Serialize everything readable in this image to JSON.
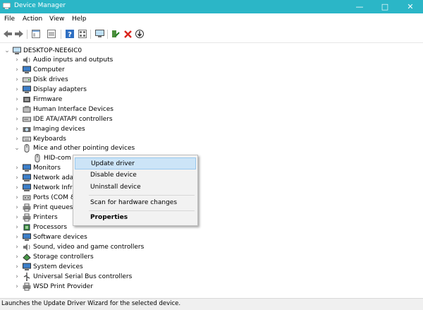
{
  "window": {
    "title": "Device Manager",
    "accent": "#2bb6c7",
    "controls": [
      "minimize-icon",
      "maximize-icon",
      "close-icon"
    ]
  },
  "menubar": [
    "File",
    "Action",
    "View",
    "Help"
  ],
  "toolbar": [
    "back-arrow-icon",
    "forward-arrow-icon",
    "console-tree-icon",
    "properties-icon",
    "help-icon",
    "view-icon",
    "monitor-icon",
    "add-driver-icon",
    "uninstall-x-icon",
    "download-icon"
  ],
  "tree": {
    "root": "DESKTOP-NEE6IC0",
    "items": [
      {
        "label": "Audio inputs and outputs",
        "icon": "speaker-icon"
      },
      {
        "label": "Computer",
        "icon": "computer-icon"
      },
      {
        "label": "Disk drives",
        "icon": "disk-icon"
      },
      {
        "label": "Display adapters",
        "icon": "display-adapter-icon"
      },
      {
        "label": "Firmware",
        "icon": "firmware-icon"
      },
      {
        "label": "Human Interface Devices",
        "icon": "hid-icon"
      },
      {
        "label": "IDE ATA/ATAPI controllers",
        "icon": "ide-icon"
      },
      {
        "label": "Imaging devices",
        "icon": "camera-icon"
      },
      {
        "label": "Keyboards",
        "icon": "keyboard-icon"
      },
      {
        "label": "Mice and other pointing devices",
        "icon": "mouse-icon",
        "expanded": true
      },
      {
        "label": "HID-com",
        "icon": "mouse-icon",
        "child": true
      },
      {
        "label": "Monitors",
        "icon": "monitor-icon"
      },
      {
        "label": "Network adap",
        "icon": "network-icon"
      },
      {
        "label": "Network Infra",
        "icon": "network-icon"
      },
      {
        "label": "Ports (COM &",
        "icon": "port-icon"
      },
      {
        "label": "Print queues",
        "icon": "printer-icon"
      },
      {
        "label": "Printers",
        "icon": "printer-icon"
      },
      {
        "label": "Processors",
        "icon": "processor-icon"
      },
      {
        "label": "Software devices",
        "icon": "software-icon"
      },
      {
        "label": "Sound, video and game controllers",
        "icon": "speaker-icon"
      },
      {
        "label": "Storage controllers",
        "icon": "storage-icon"
      },
      {
        "label": "System devices",
        "icon": "system-icon"
      },
      {
        "label": "Universal Serial Bus controllers",
        "icon": "usb-icon"
      },
      {
        "label": "WSD Print Provider",
        "icon": "printer-icon"
      }
    ]
  },
  "context_menu": {
    "items": [
      {
        "label": "Update driver",
        "highlighted": true
      },
      {
        "label": "Disable device"
      },
      {
        "label": "Uninstall device"
      },
      {
        "label": "Scan for hardware changes"
      },
      {
        "label": "Properties",
        "bold": true
      }
    ]
  },
  "status": "Launches the Update Driver Wizard for the selected device."
}
